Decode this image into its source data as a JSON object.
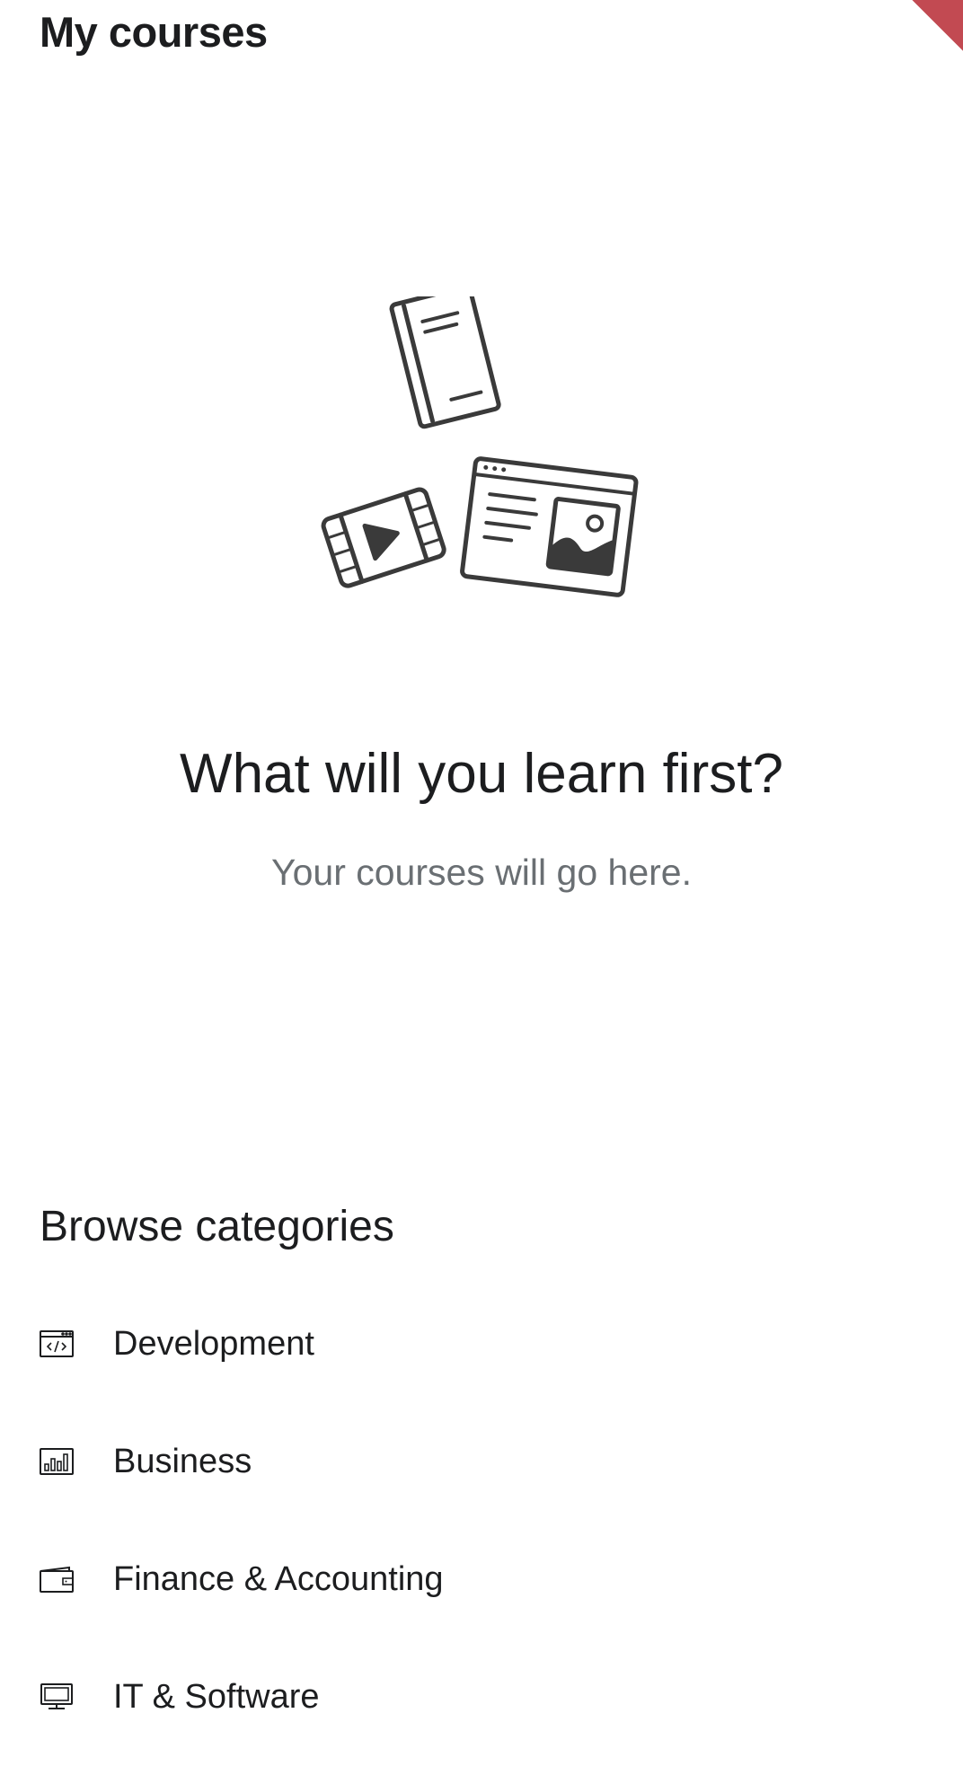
{
  "header": {
    "title": "My courses"
  },
  "empty_state": {
    "heading": "What will you learn first?",
    "subtext": "Your courses will go here.",
    "illustration_icons": [
      "book-icon",
      "video-play-icon",
      "browser-window-icon"
    ]
  },
  "browse": {
    "title": "Browse categories",
    "categories": [
      {
        "label": "Development",
        "icon": "code-window-icon"
      },
      {
        "label": "Business",
        "icon": "bar-chart-icon"
      },
      {
        "label": "Finance & Accounting",
        "icon": "wallet-icon"
      },
      {
        "label": "IT & Software",
        "icon": "monitor-icon"
      }
    ]
  },
  "colors": {
    "text_primary": "#1c1d1f",
    "text_secondary": "#6a6f73",
    "accent": "#c24a52",
    "background": "#ffffff"
  }
}
